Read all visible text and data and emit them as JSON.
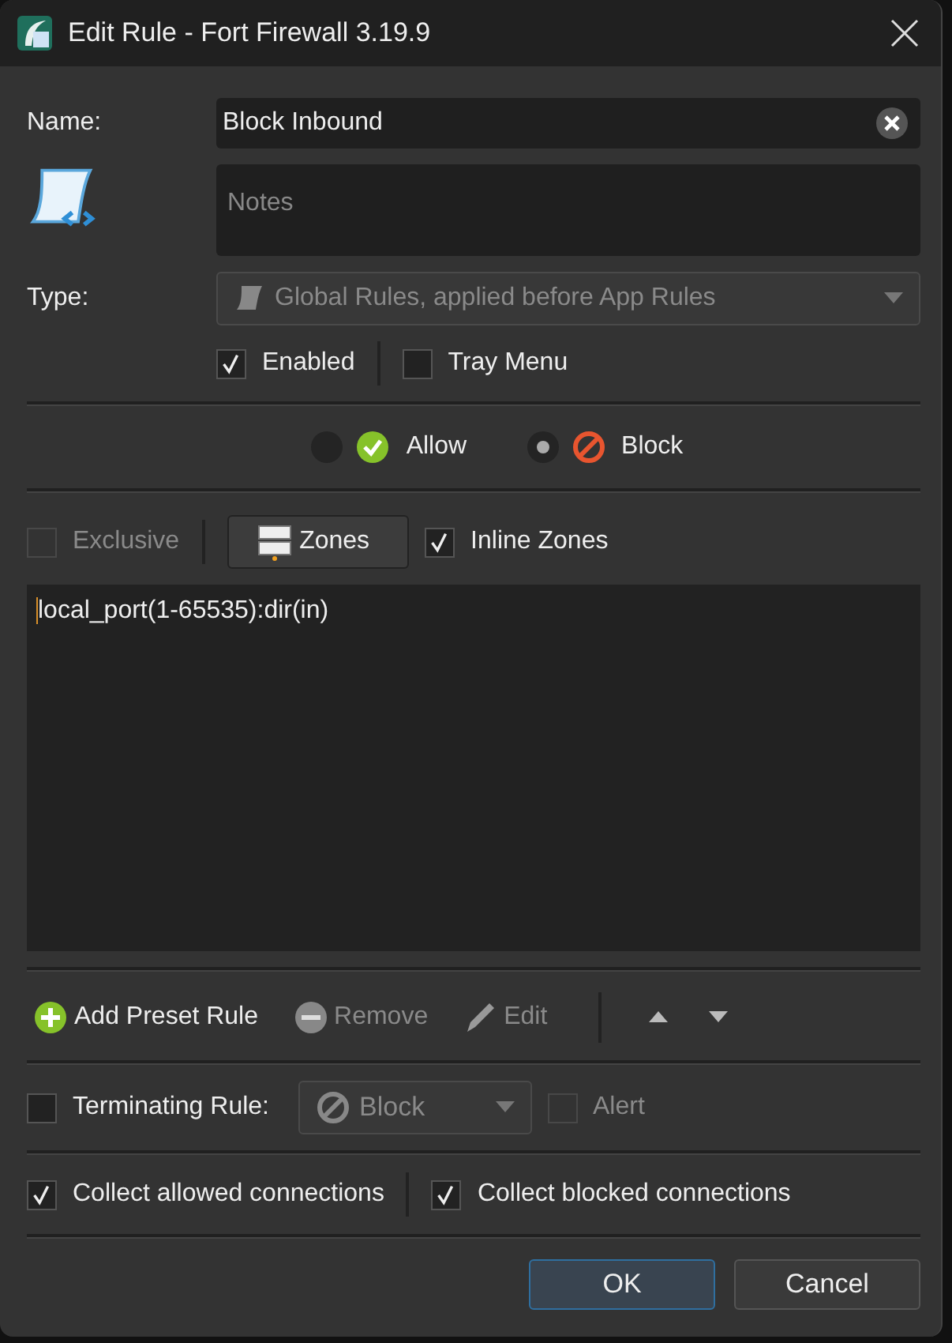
{
  "window": {
    "title": "Edit Rule - Fort Firewall 3.19.9"
  },
  "name": {
    "label": "Name:",
    "value": "Block Inbound"
  },
  "notes": {
    "placeholder": "Notes"
  },
  "type": {
    "label": "Type:",
    "value": "Global Rules, applied before App Rules",
    "disabled": true
  },
  "options": [
    {
      "label": "Enabled",
      "checked": true
    },
    {
      "label": "Tray Menu",
      "checked": false
    }
  ],
  "action": [
    {
      "label": "Allow",
      "selected": false,
      "kind": "allow"
    },
    {
      "label": "Block",
      "selected": true,
      "kind": "block"
    }
  ],
  "exclusive": {
    "label": "Exclusive",
    "checked": false,
    "disabled": true
  },
  "zones_button": {
    "label": "Zones"
  },
  "inline_zones": {
    "label": "Inline Zones",
    "checked": true
  },
  "rule_text": "local_port(1-65535):dir(in)",
  "toolbar": [
    {
      "label": "Add Preset Rule",
      "kind": "add",
      "disabled": false
    },
    {
      "label": "Remove",
      "kind": "remove",
      "disabled": true
    },
    {
      "label": "Edit",
      "kind": "edit",
      "disabled": true
    }
  ],
  "terminating": {
    "label": "Terminating Rule:",
    "checked": false
  },
  "terminating_action": {
    "value": "Block",
    "disabled": true
  },
  "alert": {
    "label": "Alert",
    "checked": false,
    "disabled": true
  },
  "collect": [
    {
      "label": "Collect allowed connections",
      "checked": true
    },
    {
      "label": "Collect blocked connections",
      "checked": true
    }
  ],
  "buttons": [
    {
      "label": "OK",
      "default": true
    },
    {
      "label": "Cancel",
      "default": false
    }
  ]
}
